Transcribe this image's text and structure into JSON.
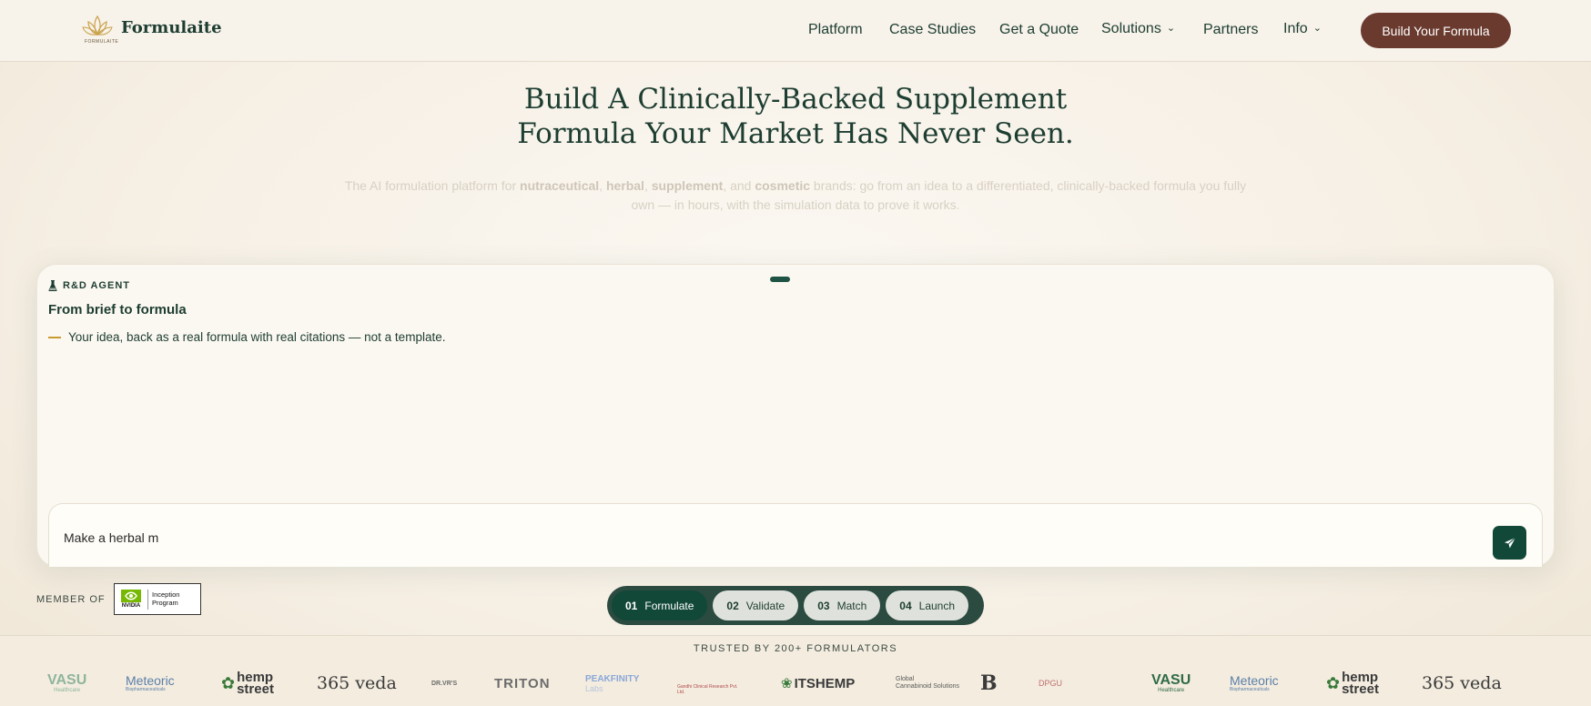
{
  "nav": {
    "logo_text": "Formulaite",
    "logo_sub": "FORMULAITE",
    "links": [
      {
        "label": "Platform",
        "dropdown": false
      },
      {
        "label": "Case Studies",
        "dropdown": false
      },
      {
        "label": "Get a Quote",
        "dropdown": false
      },
      {
        "label": "Solutions",
        "dropdown": true
      },
      {
        "label": "Partners",
        "dropdown": false
      },
      {
        "label": "Info",
        "dropdown": true
      }
    ],
    "cta": "Build Your Formula"
  },
  "hero": {
    "title_line1": "Build A Clinically-Backed Supplement",
    "title_line2": "Formula Your Market Has Never Seen.",
    "sub_parts": [
      {
        "text": "The AI formulation platform for ",
        "bold": false
      },
      {
        "text": "nutraceutical",
        "bold": true
      },
      {
        "text": ", ",
        "bold": false
      },
      {
        "text": "herbal",
        "bold": true
      },
      {
        "text": ", ",
        "bold": false
      },
      {
        "text": "supplement",
        "bold": true
      },
      {
        "text": ", and ",
        "bold": false
      },
      {
        "text": "cosmetic",
        "bold": true
      },
      {
        "text": " brands: go from an idea to a differentiated, clinically-backed formula you fully own — in hours, with the simulation data to prove it works.",
        "bold": false
      }
    ]
  },
  "agent": {
    "tag": "R&D AGENT",
    "title": "From brief to formula",
    "line": "Your idea, back as a real formula with real citations — not a template.",
    "input_value": "Make a herbal m",
    "send_icon": "send-icon"
  },
  "member": {
    "label": "MEMBER OF",
    "badge_brand": "NVIDIA",
    "badge_line1": "Inception",
    "badge_line2": "Program"
  },
  "steps": [
    {
      "num": "01",
      "label": "Formulate",
      "active": true
    },
    {
      "num": "02",
      "label": "Validate",
      "active": false
    },
    {
      "num": "03",
      "label": "Match",
      "active": false
    },
    {
      "num": "04",
      "label": "Launch",
      "active": false
    }
  ],
  "trusted": {
    "label": "TRUSTED BY 200+ FORMULATORS",
    "logos": [
      {
        "name": "VASU",
        "sub": "Healthcare",
        "color": "#8fb59a"
      },
      {
        "name": "Meteoric",
        "sub": "Biopharmaceuticals",
        "color": "#5b7fa8"
      },
      {
        "name": "hemp",
        "sub": "street",
        "color": "#3a3a3a"
      },
      {
        "name": "365 veda",
        "sub": "",
        "color": "#3a3a3a"
      },
      {
        "name": "DR.VR'S",
        "sub": "",
        "color": "#6b6b6b"
      },
      {
        "name": "TRITON",
        "sub": "",
        "color": "#6b6b6b"
      },
      {
        "name": "PEAKFINITY",
        "sub": "Labs",
        "color": "#8aa8d8"
      },
      {
        "name": "Gandhi Clinical Research Pvt. Ltd.",
        "sub": "",
        "color": "#b04a4a"
      },
      {
        "name": "ITSHEMP",
        "sub": "",
        "color": "#3a3a3a"
      },
      {
        "name": "Global",
        "sub": "Cannabinoid Solutions",
        "color": "#5a5a5a"
      },
      {
        "name": "B",
        "sub": "",
        "color": "#3a3a3a"
      },
      {
        "name": "DPGU",
        "sub": "",
        "color": "#c07070"
      },
      {
        "name": "VASU",
        "sub": "Healthcare",
        "color": "#2f6b46"
      },
      {
        "name": "Meteoric",
        "sub": "Biopharmaceuticals",
        "color": "#5b7fa8"
      },
      {
        "name": "hemp",
        "sub": "street",
        "color": "#3a3a3a"
      },
      {
        "name": "365 veda",
        "sub": "",
        "color": "#3a3a3a"
      }
    ]
  },
  "colors": {
    "brand_green": "#124838",
    "cta_brown": "#6a3a2e",
    "accent_gold": "#c99a2e"
  }
}
